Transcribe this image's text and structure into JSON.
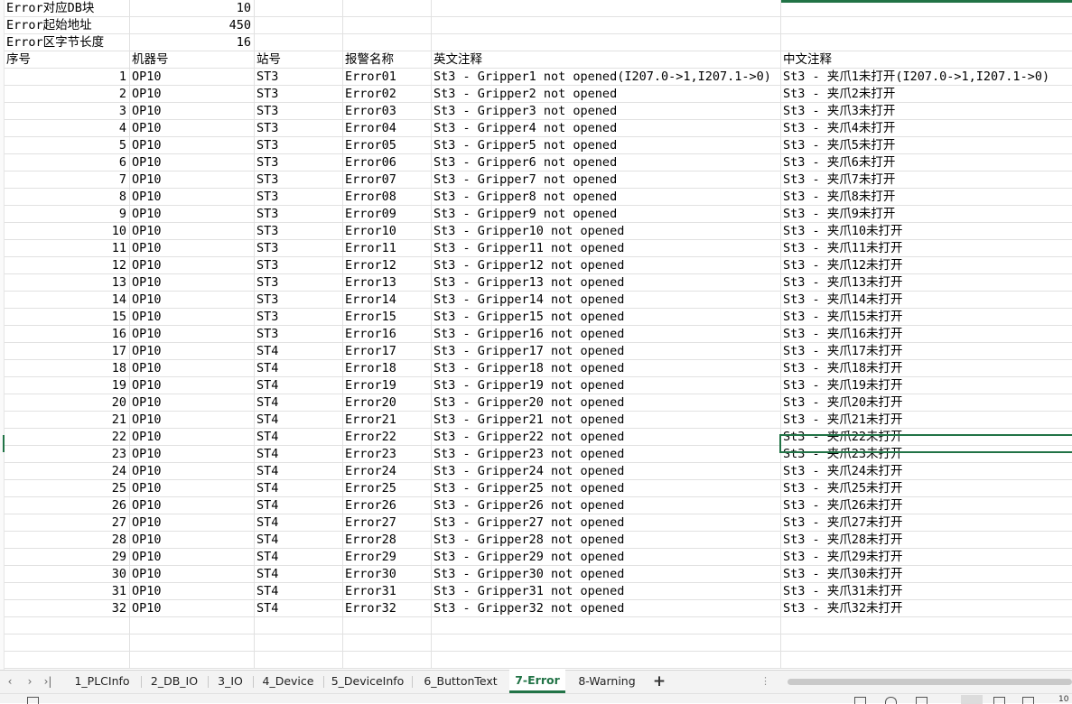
{
  "header_rows": [
    {
      "label": "Error对应DB块",
      "value": "10"
    },
    {
      "label": "Error起始地址",
      "value": "450"
    },
    {
      "label": "Error区字节长度",
      "value": "16"
    }
  ],
  "columns": [
    "序号",
    "机器号",
    "站号",
    "报警名称",
    "英文注释",
    "中文注释"
  ],
  "rows": [
    [
      "1",
      "OP10",
      "ST3",
      "Error01",
      "St3 - Gripper1 not opened(I207.0->1,I207.1->0)",
      "St3 - 夹爪1未打开(I207.0->1,I207.1->0)"
    ],
    [
      "2",
      "OP10",
      "ST3",
      "Error02",
      "St3 - Gripper2 not opened",
      "St3 - 夹爪2未打开"
    ],
    [
      "3",
      "OP10",
      "ST3",
      "Error03",
      "St3 - Gripper3 not opened",
      "St3 - 夹爪3未打开"
    ],
    [
      "4",
      "OP10",
      "ST3",
      "Error04",
      "St3 - Gripper4 not opened",
      "St3 - 夹爪4未打开"
    ],
    [
      "5",
      "OP10",
      "ST3",
      "Error05",
      "St3 - Gripper5 not opened",
      "St3 - 夹爪5未打开"
    ],
    [
      "6",
      "OP10",
      "ST3",
      "Error06",
      "St3 - Gripper6 not opened",
      "St3 - 夹爪6未打开"
    ],
    [
      "7",
      "OP10",
      "ST3",
      "Error07",
      "St3 - Gripper7 not opened",
      "St3 - 夹爪7未打开"
    ],
    [
      "8",
      "OP10",
      "ST3",
      "Error08",
      "St3 - Gripper8 not opened",
      "St3 - 夹爪8未打开"
    ],
    [
      "9",
      "OP10",
      "ST3",
      "Error09",
      "St3 - Gripper9 not opened",
      "St3 - 夹爪9未打开"
    ],
    [
      "10",
      "OP10",
      "ST3",
      "Error10",
      "St3 - Gripper10 not opened",
      "St3 - 夹爪10未打开"
    ],
    [
      "11",
      "OP10",
      "ST3",
      "Error11",
      "St3 - Gripper11 not opened",
      "St3 - 夹爪11未打开"
    ],
    [
      "12",
      "OP10",
      "ST3",
      "Error12",
      "St3 - Gripper12 not opened",
      "St3 - 夹爪12未打开"
    ],
    [
      "13",
      "OP10",
      "ST3",
      "Error13",
      "St3 - Gripper13 not opened",
      "St3 - 夹爪13未打开"
    ],
    [
      "14",
      "OP10",
      "ST3",
      "Error14",
      "St3 - Gripper14 not opened",
      "St3 - 夹爪14未打开"
    ],
    [
      "15",
      "OP10",
      "ST3",
      "Error15",
      "St3 - Gripper15 not opened",
      "St3 - 夹爪15未打开"
    ],
    [
      "16",
      "OP10",
      "ST3",
      "Error16",
      "St3 - Gripper16 not opened",
      "St3 - 夹爪16未打开"
    ],
    [
      "17",
      "OP10",
      "ST4",
      "Error17",
      "St3 - Gripper17 not opened",
      "St3 - 夹爪17未打开"
    ],
    [
      "18",
      "OP10",
      "ST4",
      "Error18",
      "St3 - Gripper18 not opened",
      "St3 - 夹爪18未打开"
    ],
    [
      "19",
      "OP10",
      "ST4",
      "Error19",
      "St3 - Gripper19 not opened",
      "St3 - 夹爪19未打开"
    ],
    [
      "20",
      "OP10",
      "ST4",
      "Error20",
      "St3 - Gripper20 not opened",
      "St3 - 夹爪20未打开"
    ],
    [
      "21",
      "OP10",
      "ST4",
      "Error21",
      "St3 - Gripper21 not opened",
      "St3 - 夹爪21未打开"
    ],
    [
      "22",
      "OP10",
      "ST4",
      "Error22",
      "St3 - Gripper22 not opened",
      "St3 - 夹爪22未打开"
    ],
    [
      "23",
      "OP10",
      "ST4",
      "Error23",
      "St3 - Gripper23 not opened",
      "St3 - 夹爪23未打开"
    ],
    [
      "24",
      "OP10",
      "ST4",
      "Error24",
      "St3 - Gripper24 not opened",
      "St3 - 夹爪24未打开"
    ],
    [
      "25",
      "OP10",
      "ST4",
      "Error25",
      "St3 - Gripper25 not opened",
      "St3 - 夹爪25未打开"
    ],
    [
      "26",
      "OP10",
      "ST4",
      "Error26",
      "St3 - Gripper26 not opened",
      "St3 - 夹爪26未打开"
    ],
    [
      "27",
      "OP10",
      "ST4",
      "Error27",
      "St3 - Gripper27 not opened",
      "St3 - 夹爪27未打开"
    ],
    [
      "28",
      "OP10",
      "ST4",
      "Error28",
      "St3 - Gripper28 not opened",
      "St3 - 夹爪28未打开"
    ],
    [
      "29",
      "OP10",
      "ST4",
      "Error29",
      "St3 - Gripper29 not opened",
      "St3 - 夹爪29未打开"
    ],
    [
      "30",
      "OP10",
      "ST4",
      "Error30",
      "St3 - Gripper30 not opened",
      "St3 - 夹爪30未打开"
    ],
    [
      "31",
      "OP10",
      "ST4",
      "Error31",
      "St3 - Gripper31 not opened",
      "St3 - 夹爪31未打开"
    ],
    [
      "32",
      "OP10",
      "ST4",
      "Error32",
      "St3 - Gripper32 not opened",
      "St3 - 夹爪32未打开"
    ]
  ],
  "selected_cell": "中文注释 row 22",
  "sheet_tabs": [
    "1_PLCInfo",
    "2_DB_IO",
    "3_IO",
    "4_Device",
    "5_DeviceInfo",
    "6_ButtonText",
    "7-Error",
    "8-Warning"
  ],
  "active_tab": "7-Error",
  "nav_icons": [
    "first-sheet-icon",
    "prev-sheet-icon",
    "next-sheet-icon",
    "last-sheet-icon"
  ],
  "status_text": "10",
  "accent_color": "#217346"
}
